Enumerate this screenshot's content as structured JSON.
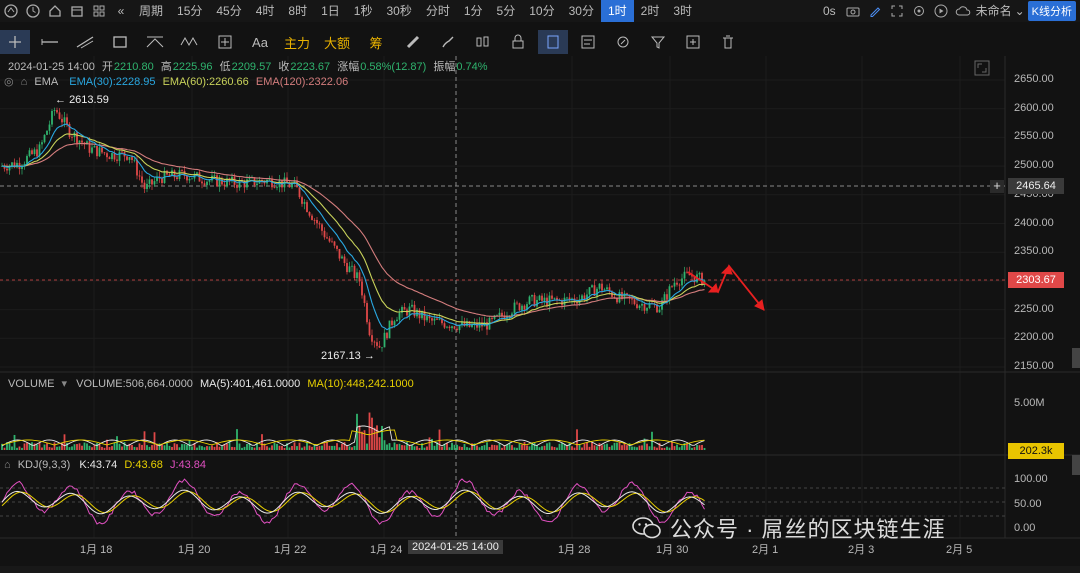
{
  "topbar": {
    "period_label": "周期",
    "timeframes": [
      "15分",
      "45分",
      "4时",
      "8时",
      "1日",
      "1秒",
      "30秒",
      "分时",
      "1分",
      "5分",
      "10分",
      "30分",
      "1时",
      "2时",
      "3时"
    ],
    "active_timeframe": "1时",
    "seconds_label": "0s",
    "layout_name": "未命名",
    "analysis_badge": "K线分析"
  },
  "drawing_tools": {
    "text_tool": "Aa",
    "main_force": "主力",
    "big_order": "大额",
    "chip": "筹"
  },
  "ohlc": {
    "datetime": "2024-01-25 14:00",
    "open_label": "开",
    "open": "2210.80",
    "high_label": "高",
    "high": "2225.96",
    "low_label": "低",
    "low": "2209.57",
    "close_label": "收",
    "close": "2223.67",
    "change_label": "涨幅",
    "change": "0.58%(12.87)",
    "amp_label": "振幅",
    "amp": "0.74%"
  },
  "ema": {
    "name": "EMA",
    "ema30": "EMA(30):2228.95",
    "ema60": "EMA(60):2260.66",
    "ema120": "EMA(120):2322.06"
  },
  "volume": {
    "name": "VOLUME",
    "value": "VOLUME:506,664.0000",
    "ma5": "MA(5):401,461.0000",
    "ma10": "MA(10):448,242.1000",
    "axis_max": "5.00M",
    "current": "202.3k"
  },
  "kdj": {
    "name": "KDJ(9,3,3)",
    "k": "K:43.74",
    "d": "D:43.68",
    "j": "J:43.84",
    "axis": [
      "100.00",
      "50.00",
      "0.00"
    ]
  },
  "price_axis": [
    "2650.00",
    "2600.00",
    "2550.00",
    "2500.00",
    "2450.00",
    "2400.00",
    "2350.00",
    "2300.00",
    "2250.00",
    "2200.00",
    "2150.00"
  ],
  "crosshair_price": "2465.64",
  "last_price": "2303.67",
  "annotations": {
    "high": "2613.59",
    "low": "2167.13"
  },
  "dates": [
    "1月 18",
    "1月 20",
    "1月 22",
    "1月 24",
    "1月 28",
    "1月 30",
    "2月 1",
    "2月 3",
    "2月 5"
  ],
  "crosshair_date": "2024-01-25 14:00",
  "watermark": "公众号 · 屌丝的区块链生涯",
  "colors": {
    "up": "#2fb36e",
    "down": "#e04848",
    "ema30": "#29a7e0",
    "ema60": "#c8d25a",
    "ema120": "#d47d7d",
    "accent": "#2a6fd6"
  },
  "chart_data": {
    "type": "candlestick",
    "series": [
      {
        "name": "EMA(30)"
      },
      {
        "name": "EMA(60)"
      },
      {
        "name": "EMA(120)"
      }
    ],
    "y_range": [
      2150,
      2650
    ],
    "extremes": {
      "high": 2613.59,
      "low": 2167.13
    },
    "last_price": 2303.67
  }
}
